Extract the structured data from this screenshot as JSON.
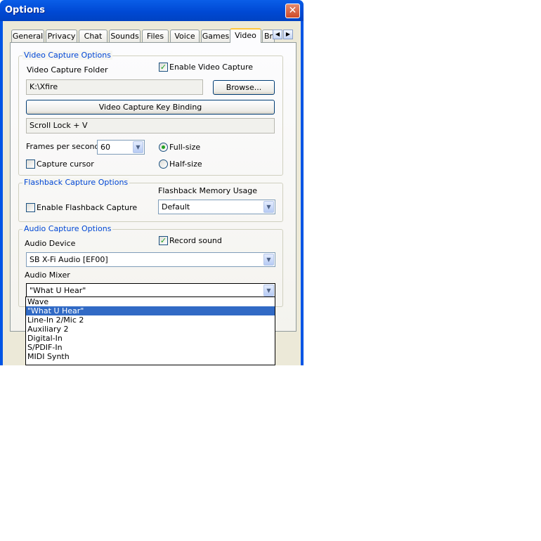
{
  "window": {
    "title": "Options",
    "close_glyph": "✕"
  },
  "tabs": [
    {
      "label": "General"
    },
    {
      "label": "Privacy"
    },
    {
      "label": "Chat"
    },
    {
      "label": "Sounds"
    },
    {
      "label": "Files"
    },
    {
      "label": "Voice"
    },
    {
      "label": "Games"
    },
    {
      "label": "Video",
      "active": true
    },
    {
      "label": "Br"
    }
  ],
  "tab_scroll": {
    "left_icon": "◀",
    "right_icon": "▶"
  },
  "video_capture": {
    "group_label": "Video Capture Options",
    "folder_label": "Video Capture Folder",
    "enable_label": "Enable Video Capture",
    "enable_checked": true,
    "folder_value": "K:\\Xfire",
    "browse_label": "Browse...",
    "key_binding_button": "Video Capture Key Binding",
    "key_binding_value": "Scroll Lock + V",
    "fps_label": "Frames per second",
    "fps_value": "60",
    "size_full_label": "Full-size",
    "size_half_label": "Half-size",
    "size_selected": "full",
    "capture_cursor_label": "Capture cursor",
    "capture_cursor_checked": false
  },
  "flashback": {
    "group_label": "Flashback Capture Options",
    "memory_label": "Flashback Memory Usage",
    "enable_label": "Enable Flashback Capture",
    "enable_checked": false,
    "memory_value": "Default"
  },
  "audio": {
    "group_label": "Audio Capture Options",
    "device_label": "Audio Device",
    "record_label": "Record sound",
    "record_checked": true,
    "device_value": "SB X-Fi Audio [EF00]",
    "mixer_label": "Audio Mixer",
    "mixer_value": "\"What U Hear\"",
    "mixer_options": [
      "Wave",
      "\"What U Hear\"",
      "Line-In 2/Mic 2",
      "Auxiliary 2",
      "Digital-In",
      "S/PDIF-In",
      "MIDI Synth"
    ],
    "mixer_selected_index": 1
  },
  "icons": {
    "dropdown": "chevron-down-icon",
    "check": "checkmark-icon"
  },
  "colors": {
    "title_bar": "#0055e5",
    "group_label": "#0046d5",
    "selection": "#316ac5",
    "active_tab_accent": "#ffc73c"
  }
}
